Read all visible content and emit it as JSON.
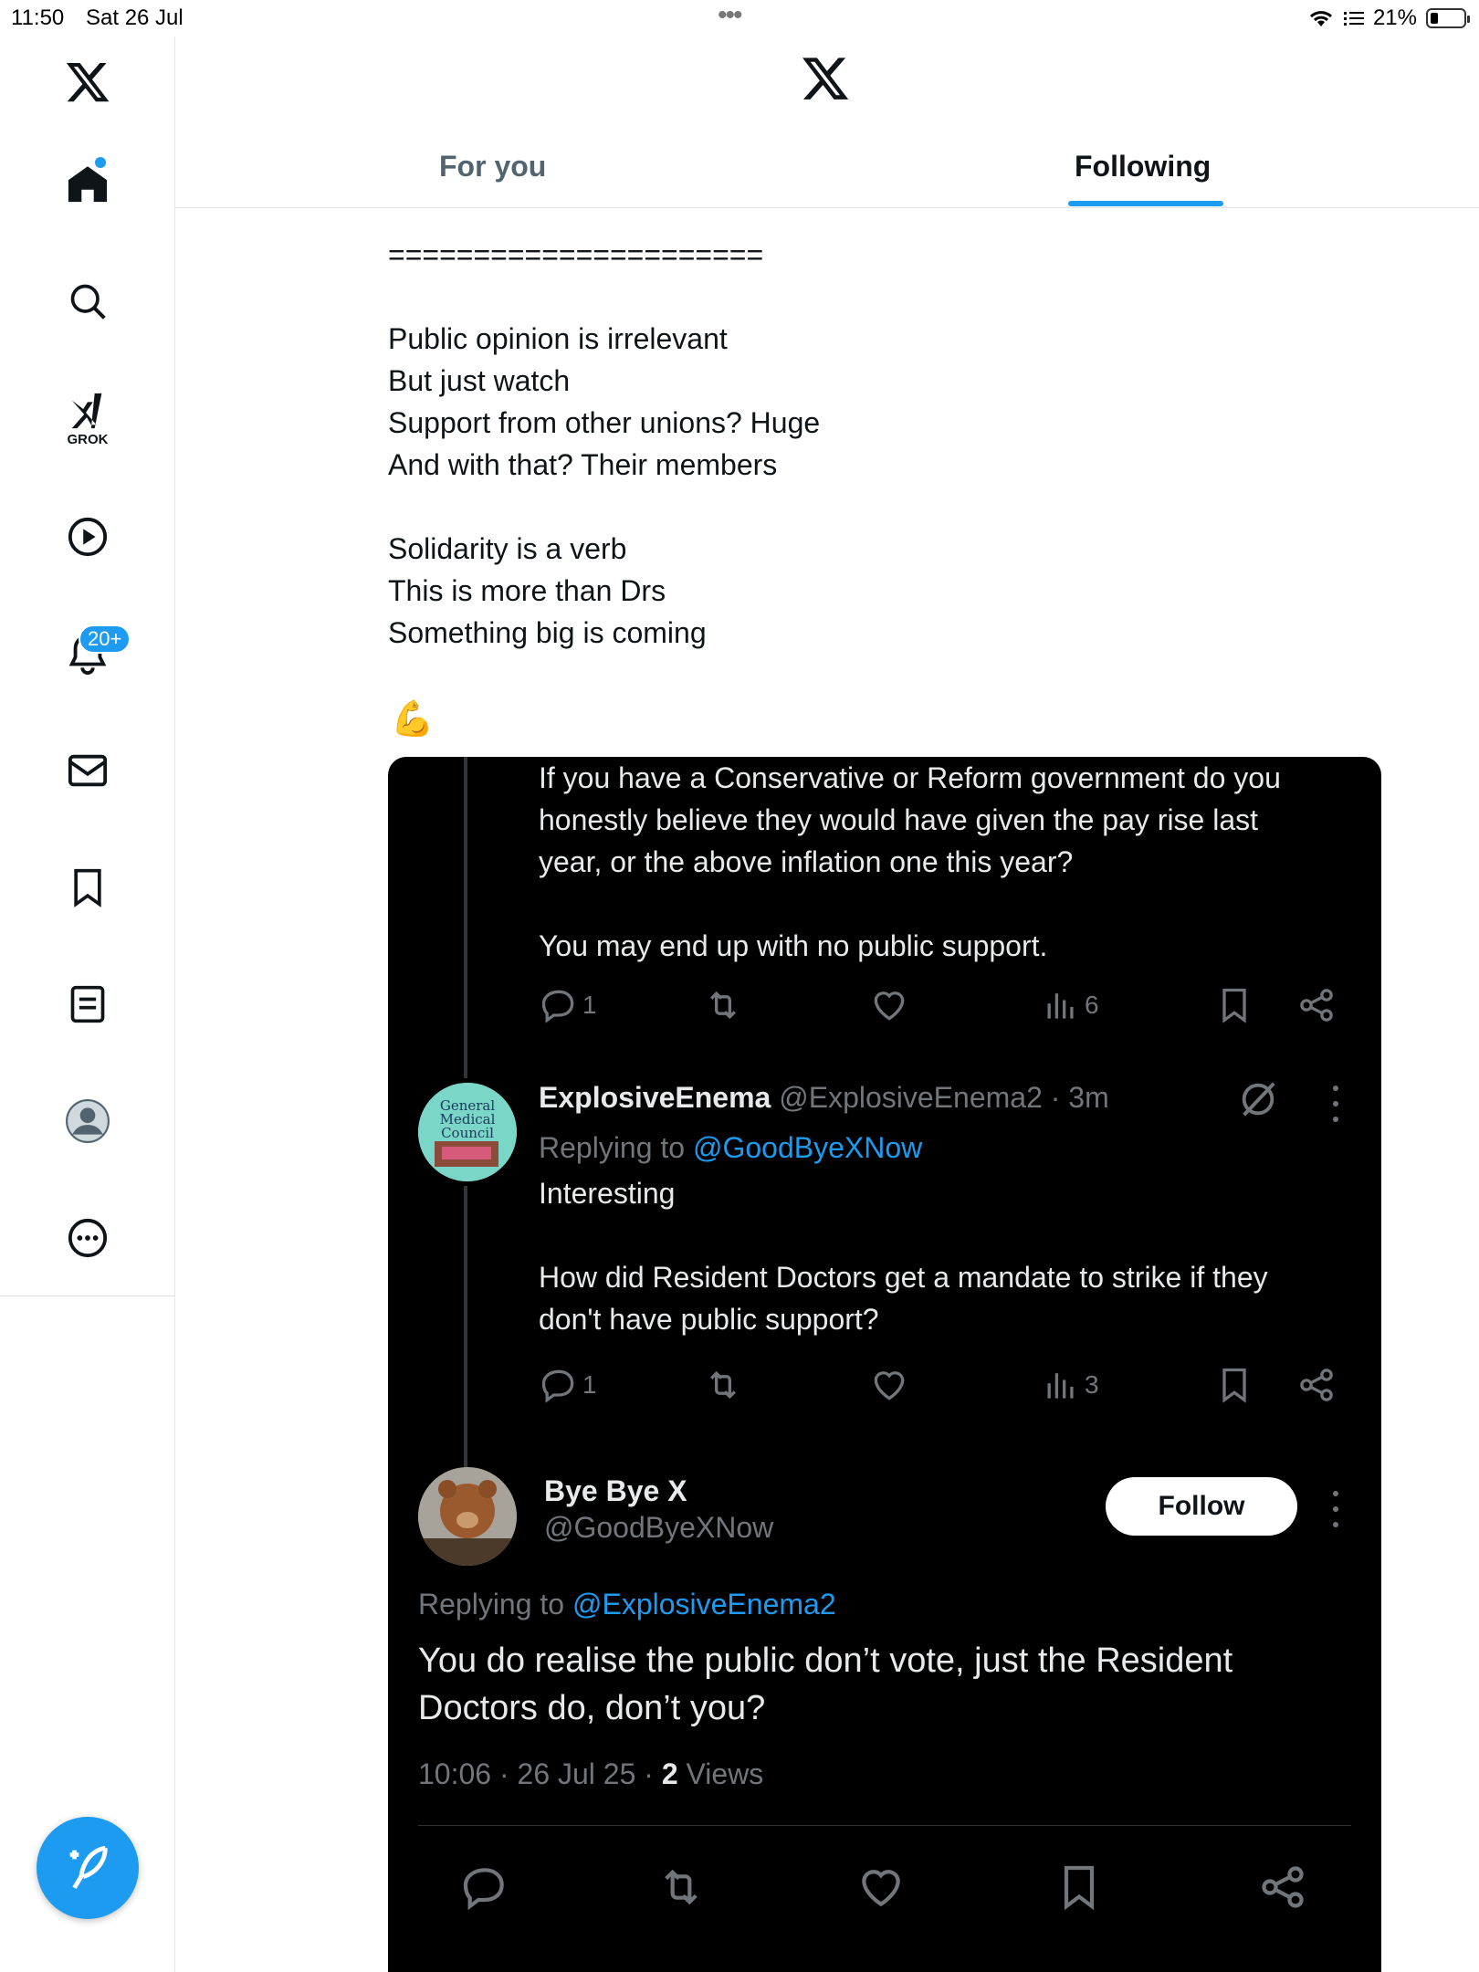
{
  "status_bar": {
    "time": "11:50",
    "date": "Sat 26 Jul",
    "battery": "21%"
  },
  "sidebar": {
    "notifications_badge": "20+",
    "grok_label": "GROK",
    "items": [
      "x-logo",
      "home-icon",
      "search-icon",
      "grok-icon",
      "play-icon",
      "bell-icon",
      "mail-icon",
      "bookmark-icon",
      "lists-icon",
      "profile-icon",
      "more-icon"
    ]
  },
  "tabs": {
    "for_you": "For you",
    "following": "Following"
  },
  "post": {
    "text": "======================\n\nPublic opinion is irrelevant\nBut just watch\nSupport from other unions? Huge\nAnd with that? Their members\n\nSolidarity is a verb\nThis is more than Drs\nSomething big is coming",
    "emoji": "💪"
  },
  "embed": {
    "first_reply": {
      "text": "If you have a Conservative or Reform government do you\nhonestly believe they would have given the pay rise last\nyear, or the above inflation one this year?\n\nYou may end up with no public support.",
      "replies": "1",
      "views": "6"
    },
    "second_reply": {
      "name": "ExplosiveEnema",
      "handle": "@ExplosiveEnema2 · 3m",
      "replying_prefix": "Replying to ",
      "replying_to": "@GoodByeXNow",
      "text": "Interesting\n\nHow did Resident Doctors get a mandate to strike if they\ndon't have public support?",
      "replies": "1",
      "views": "3",
      "avatar_text": "General Medical Council"
    },
    "main_tweet": {
      "name": "Bye Bye X",
      "handle": "@GoodByeXNow",
      "follow_label": "Follow",
      "replying_prefix": "Replying to ",
      "replying_to": "@ExplosiveEnema2",
      "text": "You do realise the public don’t vote, just the Resident\nDoctors do, don’t you?",
      "timestamp": "10:06 · 26 Jul 25 · ",
      "views_count": "2",
      "views_label": " Views"
    }
  },
  "colors": {
    "accent": "#1d9bf0",
    "embed_bg": "#000000",
    "muted": "#71767b"
  }
}
